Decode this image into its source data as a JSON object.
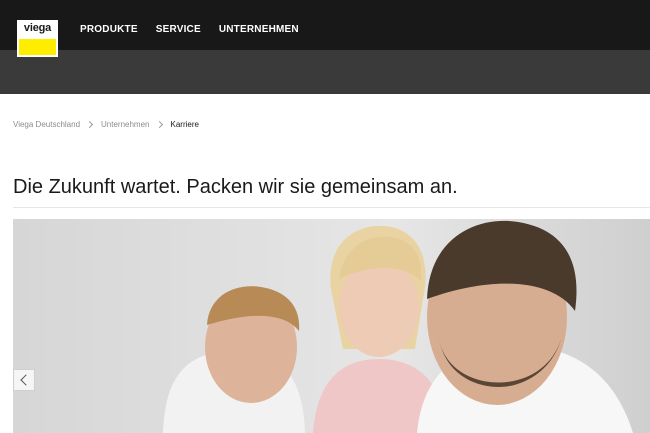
{
  "header": {
    "logo_text": "viega",
    "nav": [
      {
        "label": "PRODUKTE"
      },
      {
        "label": "SERVICE"
      },
      {
        "label": "UNTERNEHMEN"
      }
    ]
  },
  "breadcrumb": [
    {
      "label": "Viega Deutschland"
    },
    {
      "label": "Unternehmen"
    },
    {
      "label": "Karriere"
    }
  ],
  "page": {
    "headline": "Die Zukunft wartet. Packen wir sie gemeinsam an."
  },
  "hero": {
    "prev_icon": "chevron-left-icon"
  },
  "colors": {
    "topbar": "#181818",
    "subbar": "#3a3a3a",
    "brand_yellow": "#ffed00"
  }
}
